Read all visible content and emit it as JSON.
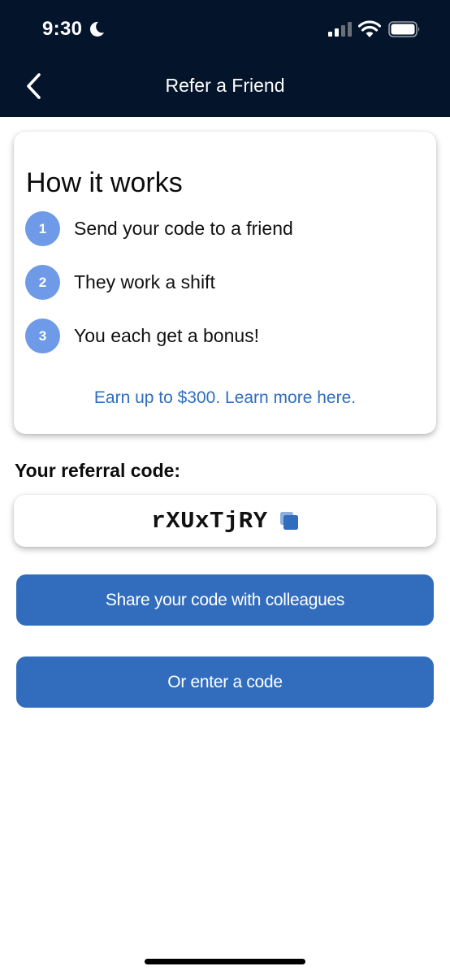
{
  "status_bar": {
    "time": "9:30",
    "icons": [
      "moon-icon",
      "cellular-signal-icon",
      "wifi-icon",
      "battery-icon"
    ]
  },
  "nav": {
    "title": "Refer a Friend",
    "back_icon": "chevron-left-icon"
  },
  "how_it_works": {
    "title": "How it works",
    "steps": [
      {
        "number": "1",
        "text": "Send your code to a friend"
      },
      {
        "number": "2",
        "text": "They work a shift"
      },
      {
        "number": "3",
        "text": "You each get a bonus!"
      }
    ],
    "link": "Earn up to $300. Learn more here."
  },
  "referral": {
    "label": "Your referral code:",
    "code": "rXUxTjRY",
    "copy_icon": "copy-icon"
  },
  "buttons": {
    "share": "Share your code with colleagues",
    "enter": "Or enter a code"
  },
  "colors": {
    "header_bg": "#03142b",
    "accent": "#326dbd",
    "step_circle": "#6f9ae8",
    "link": "#2f6dbf"
  }
}
